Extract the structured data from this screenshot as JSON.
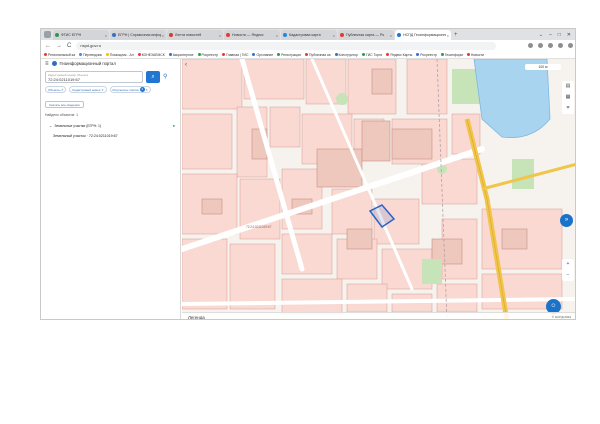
{
  "browser": {
    "tabs": [
      {
        "title": "ФГИС ЕГРН",
        "color": "#2b9b4b"
      },
      {
        "title": "ЕГРН | Справочная инфор",
        "color": "#3671c7"
      },
      {
        "title": "Лента новостей",
        "color": "#d33b2c"
      },
      {
        "title": "Новости — Яндекс",
        "color": "#e53935"
      },
      {
        "title": "Кадастровая карта",
        "color": "#1e88e5"
      },
      {
        "title": "Публичная карта — Ро",
        "color": "#e53935"
      },
      {
        "title": "НСПД Геоинформационный портал",
        "color": "#2176d2",
        "active": true
      }
    ],
    "tab_close": "×",
    "new_tab": "+",
    "window_controls": [
      "⌄",
      "–",
      "□",
      "✕"
    ],
    "address": "nspd.gov.ru",
    "nav_back": "←",
    "nav_forward": "→",
    "nav_reload": "C",
    "bookmarks": [
      {
        "label": "Региональный ка",
        "color": "#e53935"
      },
      {
        "label": "Переводчик",
        "color": "#4285f4"
      },
      {
        "label": "Помощник - Ал",
        "color": "#fbbc04"
      },
      {
        "label": "КОНЕЗАЕМСК",
        "color": "#e53935"
      },
      {
        "label": "Акционерное",
        "color": "#3671c7"
      },
      {
        "label": "Росреестр",
        "color": "#2b9b4b"
      },
      {
        "label": "Главная | ГИС",
        "color": "#e53935"
      },
      {
        "label": "Оргзнание",
        "color": "#3671c7"
      },
      {
        "label": "Регистрация",
        "color": "#2b9b4b"
      },
      {
        "label": "Публичная ка",
        "color": "#e53935"
      },
      {
        "label": "Конструктор",
        "color": "#3671c7"
      },
      {
        "label": "ГИС Торги",
        "color": "#2b9b4b"
      },
      {
        "label": "Яндекс Карты",
        "color": "#e53935"
      },
      {
        "label": "Росреестр",
        "color": "#3671c7"
      },
      {
        "label": "Геоинформ",
        "color": "#2b9b4b"
      },
      {
        "label": "Новости",
        "color": "#e53935"
      }
    ]
  },
  "portal": {
    "title": "Геоинформационный портал",
    "search_placeholder": "Кадастровый номер объекта",
    "search_value": "72:24:0211019:67",
    "chips": [
      {
        "label": "Объекты",
        "count": null
      },
      {
        "label": "Кадастровый номер",
        "count": null
      },
      {
        "label": "Результаты поиска",
        "count": "3"
      }
    ],
    "action_button": "Скачать все сведения",
    "found_label": "Найдено объектов: 1",
    "result_group": "Земельные участки (ЕГРН: 1)",
    "result_item": "Земельный участок · 72:24:0211019:67"
  },
  "map": {
    "scale": "100 м",
    "parcel_label": "72:24:0211019:67",
    "legend": "Легенда",
    "copyright": "© НСПД 2024",
    "colors": {
      "parcel_fill": "#f9d9d2",
      "parcel_stroke": "#d8998f",
      "road_yellow": "#f0c54a",
      "road_white": "#ffffff",
      "green": "#c7e3b8",
      "water": "#a9d4f0",
      "selection": "#2c63c7"
    }
  }
}
